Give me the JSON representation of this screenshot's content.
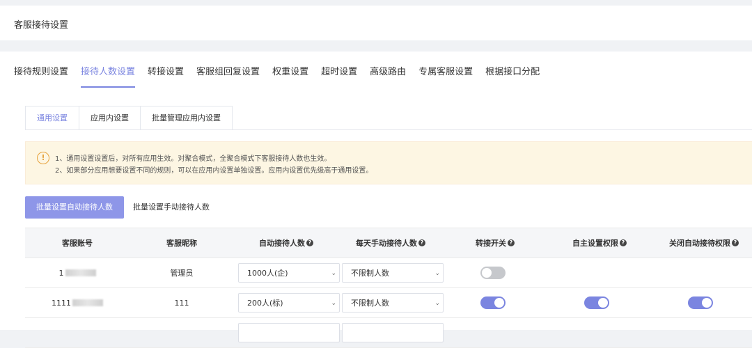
{
  "page": {
    "title": "客服接待设置"
  },
  "main_tabs": [
    {
      "label": "接待规则设置",
      "active": false
    },
    {
      "label": "接待人数设置",
      "active": true
    },
    {
      "label": "转接设置",
      "active": false
    },
    {
      "label": "客服组回复设置",
      "active": false
    },
    {
      "label": "权重设置",
      "active": false
    },
    {
      "label": "超时设置",
      "active": false
    },
    {
      "label": "高级路由",
      "active": false
    },
    {
      "label": "专属客服设置",
      "active": false
    },
    {
      "label": "根据接口分配",
      "active": false
    }
  ],
  "sub_tabs": [
    {
      "label": "通用设置",
      "active": true
    },
    {
      "label": "应用内设置",
      "active": false
    },
    {
      "label": "批量管理应用内设置",
      "active": false
    }
  ],
  "notice": {
    "line1": "1、通用设置设置后，对所有应用生效。对聚合模式，全聚合模式下客服接待人数也生效。",
    "line2": "2、如果部分应用想要设置不同的规则，可以在应用内设置单独设置。应用内设置优先级高于通用设置。"
  },
  "actions": {
    "batch_auto": "批量设置自动接待人数",
    "batch_manual": "批量设置手动接待人数"
  },
  "table": {
    "headers": {
      "account": "客服账号",
      "nickname": "客服昵称",
      "auto_count": "自动接待人数",
      "manual_count": "每天手动接待人数",
      "transfer": "转接开关",
      "self_perm": "自主设置权限",
      "close_auto_perm": "关闭自动接待权限"
    },
    "rows": [
      {
        "account": "1",
        "nickname": "管理员",
        "auto": "1000人(企)",
        "manual": "不限制人数",
        "transfer": false,
        "self_perm": null,
        "close_auto": null
      },
      {
        "account": "1111",
        "nickname": "111",
        "auto": "200人(标)",
        "manual": "不限制人数",
        "transfer": true,
        "self_perm": true,
        "close_auto": true
      }
    ]
  },
  "colors": {
    "accent": "#7b85e0",
    "primary_button": "#8e96e8",
    "notice_bg": "#fdf6e3",
    "toggle_off": "#c6c8cc"
  },
  "icons": {
    "help": "question-circle-icon",
    "warning": "exclamation-circle-icon"
  }
}
